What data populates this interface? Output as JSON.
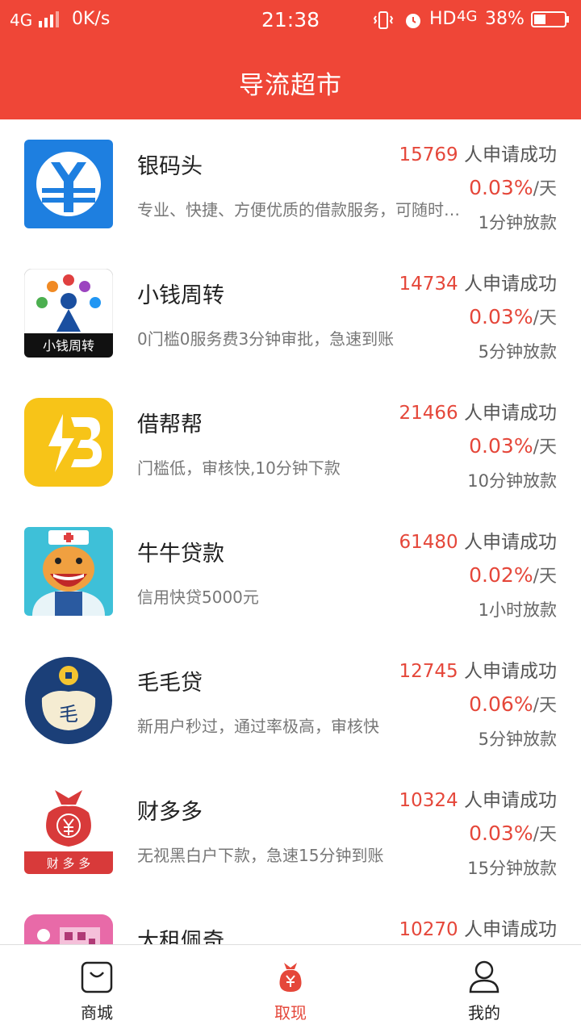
{
  "status_bar": {
    "network": "4G",
    "speed": "0K/s",
    "time": "21:38",
    "hd": "HD",
    "network2": "4G",
    "battery": "38%"
  },
  "header": {
    "title": "导流超市"
  },
  "colors": {
    "accent": "#ef4637",
    "highlight": "#e5473a"
  },
  "products": [
    {
      "name": "银码头",
      "desc": "专业、快捷、方便优质的借款服务，可随时随地",
      "count": "15769",
      "applied_label": " 人申请成功",
      "rate": "0.03%",
      "rate_unit": "/天",
      "loan_time": "1分钟放款",
      "logo_icon": "yinmatou-logo-icon"
    },
    {
      "name": "小钱周转",
      "desc": "0门槛0服务费3分钟审批，急速到账",
      "count": "14734",
      "applied_label": " 人申请成功",
      "rate": "0.03%",
      "rate_unit": "/天",
      "loan_time": "5分钟放款",
      "logo_icon": "xiaoqianzhouzhuan-logo-icon",
      "logo_text": "小钱周转"
    },
    {
      "name": "借帮帮",
      "desc": "门槛低，审核快,10分钟下款",
      "count": "21466",
      "applied_label": " 人申请成功",
      "rate": "0.03%",
      "rate_unit": "/天",
      "loan_time": "10分钟放款",
      "logo_icon": "jiebangbang-logo-icon"
    },
    {
      "name": "牛牛贷款",
      "desc": "信用快贷5000元",
      "count": "61480",
      "applied_label": " 人申请成功",
      "rate": "0.02%",
      "rate_unit": "/天",
      "loan_time": "1小时放款",
      "logo_icon": "niuniu-logo-icon"
    },
    {
      "name": "毛毛贷",
      "desc": "新用户秒过，通过率极高，审核快",
      "count": "12745",
      "applied_label": " 人申请成功",
      "rate": "0.06%",
      "rate_unit": "/天",
      "loan_time": "5分钟放款",
      "logo_icon": "maomaodai-logo-icon",
      "logo_text": "毛"
    },
    {
      "name": "财多多",
      "desc": "无视黑白户下款，急速15分钟到账",
      "count": "10324",
      "applied_label": " 人申请成功",
      "rate": "0.03%",
      "rate_unit": "/天",
      "loan_time": "15分钟放款",
      "logo_icon": "caiduoduo-logo-icon",
      "logo_text": "财 多 多"
    },
    {
      "name": "大租佩奇",
      "desc": "",
      "count": "10270",
      "applied_label": " 人申请成功",
      "rate": "",
      "rate_unit": "",
      "loan_time": "",
      "logo_icon": "dazupeiqi-logo-icon"
    }
  ],
  "tabs": [
    {
      "label": "商城",
      "icon": "shop-bag-icon",
      "active": false
    },
    {
      "label": "取现",
      "icon": "money-bag-icon",
      "active": true
    },
    {
      "label": "我的",
      "icon": "user-icon",
      "active": false
    }
  ]
}
